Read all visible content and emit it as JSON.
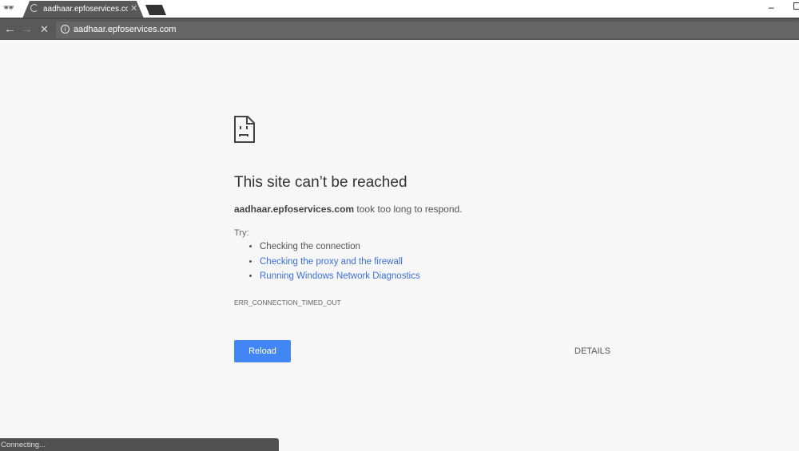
{
  "browser": {
    "tab_title": "aadhaar.epfoservices.com",
    "url": "aadhaar.epfoservices.com",
    "status": "Connecting..."
  },
  "error": {
    "title": "This site can’t be reached",
    "host": "aadhaar.epfoservices.com",
    "message": " took too long to respond.",
    "try_label": "Try:",
    "suggestions": [
      "Checking the connection",
      "Checking the proxy and the firewall",
      "Running Windows Network Diagnostics"
    ],
    "code": "ERR_CONNECTION_TIMED_OUT",
    "reload_label": "Reload",
    "details_label": "DETAILS"
  },
  "colors": {
    "accent": "#4285f4",
    "link": "#3b6fd6",
    "chrome": "#595959"
  }
}
